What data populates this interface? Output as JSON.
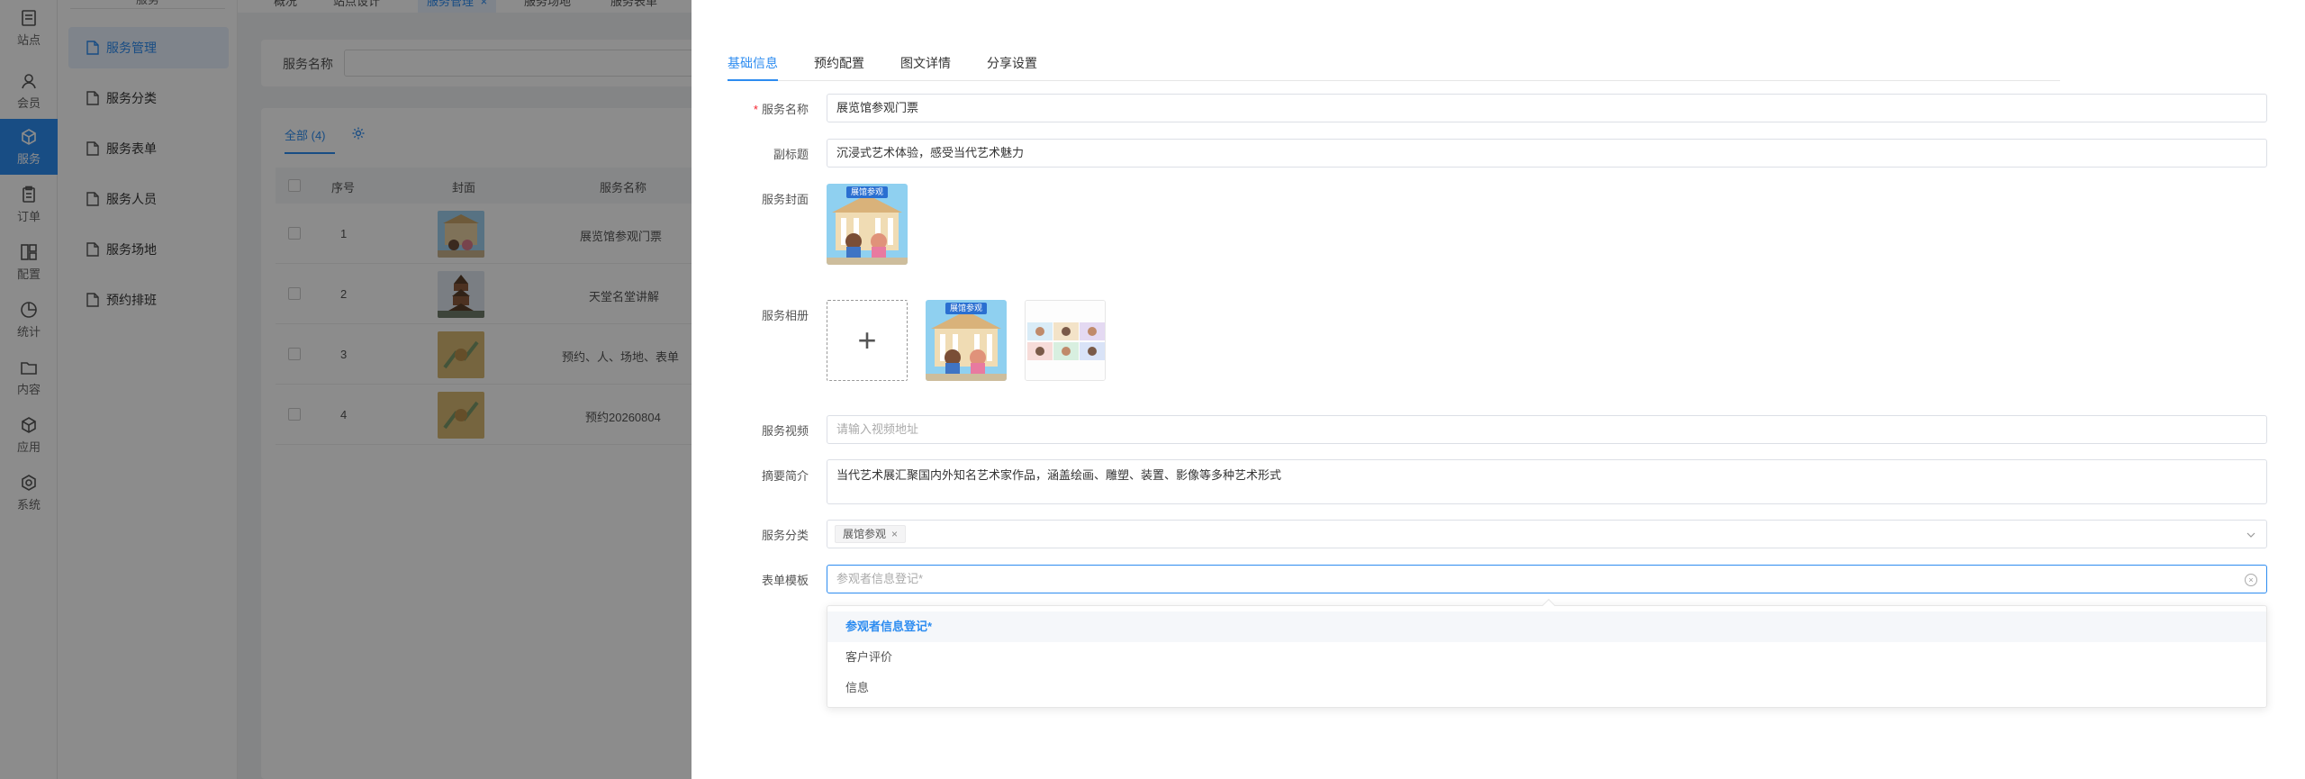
{
  "rail": {
    "items": [
      {
        "label": "站点",
        "icon": "site-icon"
      },
      {
        "label": "会员",
        "icon": "member-icon"
      },
      {
        "label": "服务",
        "icon": "service-icon"
      },
      {
        "label": "订单",
        "icon": "order-icon"
      },
      {
        "label": "配置",
        "icon": "config-icon"
      },
      {
        "label": "统计",
        "icon": "stats-icon"
      },
      {
        "label": "内容",
        "icon": "content-icon"
      },
      {
        "label": "应用",
        "icon": "app-icon"
      },
      {
        "label": "系统",
        "icon": "system-icon"
      }
    ],
    "active_index": 2
  },
  "submenu": {
    "title": "服务",
    "items": [
      "服务管理",
      "服务分类",
      "服务表单",
      "服务人员",
      "服务场地",
      "预约排班"
    ],
    "active_index": 0
  },
  "top_tabs": [
    "概况",
    "站点设计",
    "服务管理",
    "服务场地",
    "服务表单"
  ],
  "top_tab_close": "×",
  "filter": {
    "label": "服务名称"
  },
  "list": {
    "tab_label": "全部 (4)",
    "headers": [
      "序号",
      "封面",
      "服务名称"
    ],
    "rows": [
      {
        "index": "1",
        "name": "展览馆参观门票"
      },
      {
        "index": "2",
        "name": "天堂名堂讲解"
      },
      {
        "index": "3",
        "name": "预约、人、场地、表单"
      },
      {
        "index": "4",
        "name": "预约20260804"
      }
    ]
  },
  "drawer": {
    "tabs": [
      "基础信息",
      "预约配置",
      "图文详情",
      "分享设置"
    ],
    "active_tab": 0,
    "required_mark": "*",
    "fields": {
      "name_label": "服务名称",
      "name_value": "展览馆参观门票",
      "subtitle_label": "副标题",
      "subtitle_value": "沉浸式艺术体验，感受当代艺术魅力",
      "cover_label": "服务封面",
      "cover_badge": "展馆参观",
      "album_label": "服务相册",
      "album_add": "+",
      "video_label": "服务视频",
      "video_placeholder": "请输入视频地址",
      "summary_label": "摘要简介",
      "summary_value": "当代艺术展汇聚国内外知名艺术家作品，涵盖绘画、雕塑、装置、影像等多种艺术形式",
      "category_label": "服务分类",
      "category_tag": "展馆参观",
      "category_tag_close": "×",
      "form_label": "表单模板",
      "form_placeholder": "参观者信息登记*",
      "form_clear": "×"
    },
    "dropdown_options": [
      "参观者信息登记*",
      "客户评价",
      "信息"
    ],
    "dropdown_selected": 0
  },
  "colors": {
    "accent": "#2d8cf0",
    "required": "#f5222d"
  }
}
